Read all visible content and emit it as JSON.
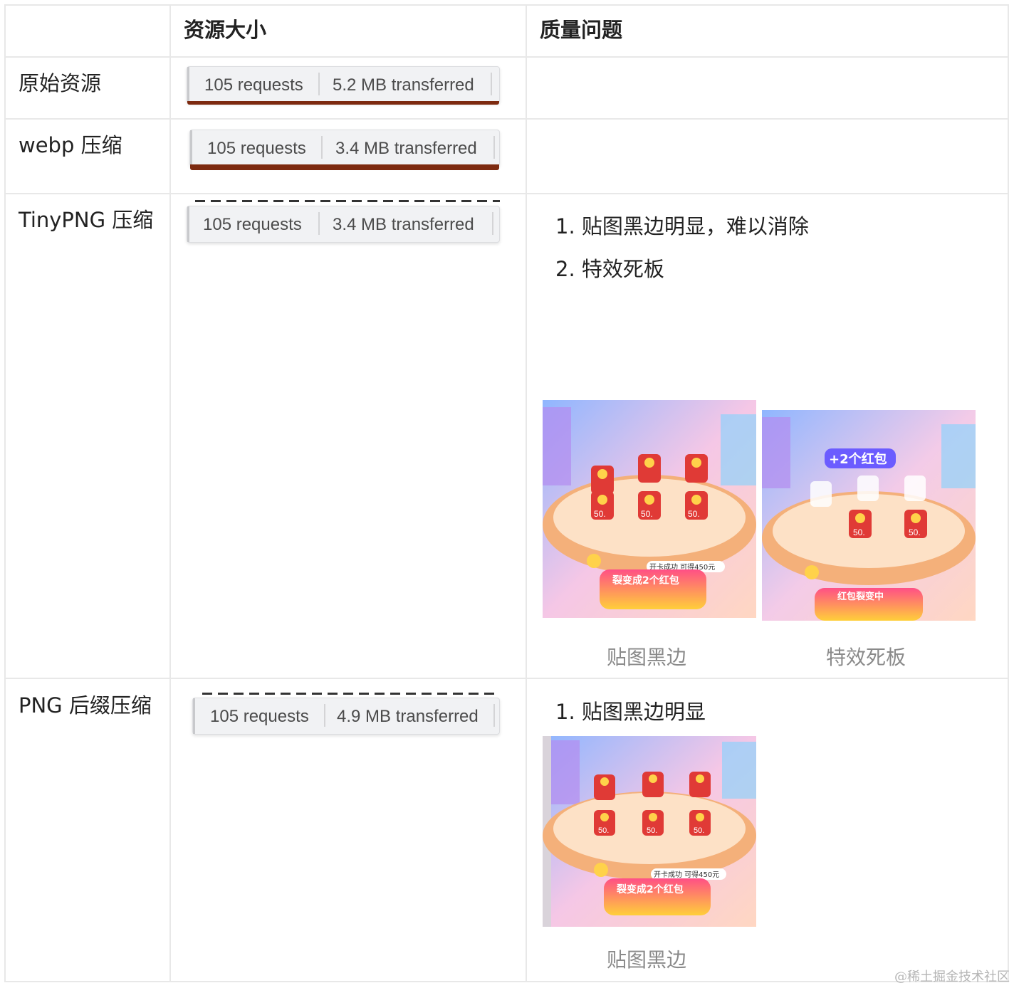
{
  "table": {
    "headers": [
      "",
      "资源大小",
      "质量问题"
    ],
    "rows": [
      {
        "label": "原始资源",
        "requests": "105 requests",
        "transferred": "5.2 MB transferred",
        "issues": []
      },
      {
        "label": "webp 压缩",
        "requests": "105 requests",
        "transferred": "3.4 MB transferred",
        "issues": []
      },
      {
        "label": "TinyPNG 压缩",
        "requests": "105 requests",
        "transferred": "3.4 MB transferred",
        "issues": [
          "1. 贴图黑边明显，难以消除",
          "2. 特效死板"
        ],
        "captions": [
          "贴图黑边",
          "特效死板"
        ]
      },
      {
        "label": "PNG 后缀压缩",
        "requests": "105 requests",
        "transferred": "4.9 MB transferred",
        "issues": [
          "1. 贴图黑边明显"
        ],
        "captions": [
          "贴图黑边"
        ]
      }
    ]
  },
  "screenshots": {
    "button_a": "裂变成2个红包",
    "button_b": "红包裂变中",
    "tag": "开卡成功 可得450元",
    "badge": "+2个红包",
    "coin_value": "50"
  },
  "watermark": "@稀土掘金技术社区",
  "colors": {
    "border": "#e8e8e8",
    "bar": "#7d2a10",
    "caption": "#8a8a8a"
  }
}
